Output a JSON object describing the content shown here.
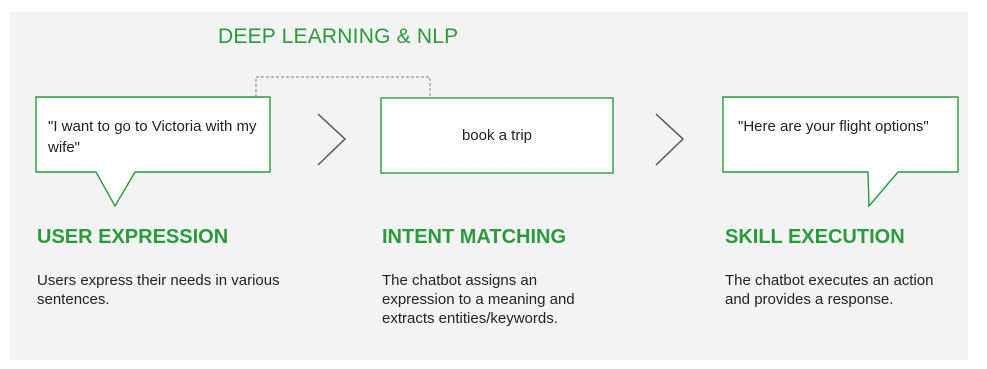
{
  "diagram": {
    "top_label": "DEEP LEARNING & NLP",
    "colors": {
      "accent_green": "#2a9a3c",
      "panel_background": "#f3f3f3",
      "box_border": "#2a9a3c",
      "connector": "#999999",
      "chevron": "#555555"
    },
    "steps": [
      {
        "box_text": "\"I want to go to Victoria with my wife\"",
        "heading": "USER EXPRESSION",
        "description": "Users express their needs in various sentences."
      },
      {
        "box_text": "book a trip",
        "heading": "INTENT MATCHING",
        "description": "The chatbot assigns an expression to a meaning and extracts entities/keywords."
      },
      {
        "box_text": "\"Here are your flight options\"",
        "heading": "SKILL EXECUTION",
        "description": "The chatbot executes an action and provides a response."
      }
    ],
    "connector_icons": [
      "chevron-right-icon",
      "chevron-right-icon"
    ]
  }
}
